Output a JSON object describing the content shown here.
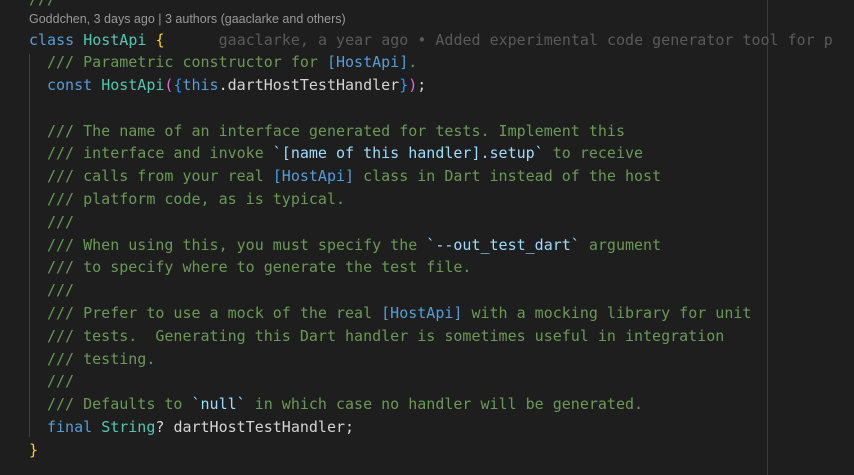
{
  "codelens": {
    "author": "Goddchen, 3 days ago",
    "separator": " | ",
    "authors": "3 authors (gaaclarke and others)"
  },
  "blame_inline": "gaaclarke, a year ago • Added experimental code generator tool for p",
  "code": {
    "class_kw": "class",
    "class_name": "HostApi",
    "open_brace": "{",
    "doc1_prefix": "/// Parametric constructor for ",
    "doc1_ref": "[HostApi]",
    "doc1_suffix": ".",
    "ctor_kw": "const",
    "ctor_name": "HostApi",
    "ctor_open_paren": "(",
    "ctor_open_brace": "{",
    "ctor_this": "this",
    "ctor_dot": ".",
    "ctor_field": "dartHostTestHandler",
    "ctor_close_brace": "}",
    "ctor_close_paren": ")",
    "ctor_semi": ";",
    "c1": "/// The name of an interface generated for tests. Implement this",
    "c2_prefix": "/// interface and invoke ",
    "c2_code": "`[name of this handler].setup`",
    "c2_suffix": " to receive",
    "c3_prefix": "/// calls from your real ",
    "c3_ref": "[HostApi]",
    "c3_suffix": " class in Dart instead of the host",
    "c4": "/// platform code, as is typical.",
    "c5": "///",
    "c6_prefix": "/// When using this, you must specify the ",
    "c6_code": "`--out_test_dart`",
    "c6_suffix": " argument",
    "c7": "/// to specify where to generate the test file.",
    "c8": "///",
    "c9_prefix": "/// Prefer to use a mock of the real ",
    "c9_ref": "[HostApi]",
    "c9_suffix": " with a mocking library for unit",
    "c10": "/// tests.  Generating this Dart handler is sometimes useful in integration",
    "c11": "/// testing.",
    "c12": "///",
    "c13_prefix": "/// Defaults to ",
    "c13_code": "`null`",
    "c13_suffix": " in which case no handler will be generated.",
    "field_kw": "final",
    "field_type": "String",
    "field_q": "?",
    "field_name": "dartHostTestHandler",
    "field_semi": ";",
    "close_brace": "}"
  }
}
